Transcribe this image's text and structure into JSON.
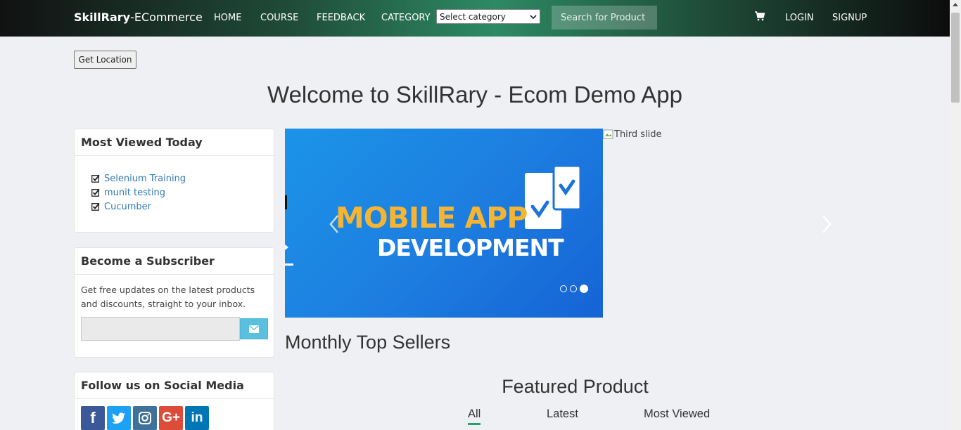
{
  "navbar": {
    "brand_bold": "SkillRary",
    "brand_rest": "-ECommerce",
    "home": "HOME",
    "course": "COURSE",
    "feedback": "FEEDBACK",
    "category": "CATEGORY",
    "category_select": "Select category",
    "search_placeholder": "Search for Product",
    "cart_icon": "shopping-cart-icon",
    "login": "LOGIN",
    "signup": "SIGNUP"
  },
  "get_location": "Get Location",
  "welcome_title": "Welcome to SkillRary - Ecom Demo App",
  "most_viewed": {
    "title": "Most Viewed Today",
    "items": [
      "Selenium Training",
      "munit testing",
      "Cucumber"
    ]
  },
  "subscriber": {
    "title": "Become a Subscriber",
    "text": "Get free updates on the latest products and discounts, straight to your inbox.",
    "button_icon": "envelope-icon"
  },
  "social": {
    "title": "Follow us on Social Media",
    "networks": [
      {
        "name": "facebook",
        "glyph": "f",
        "color": "#3b5998"
      },
      {
        "name": "twitter",
        "glyph": "t",
        "color": "#1da1f2"
      },
      {
        "name": "instagram",
        "glyph": "ig",
        "color": "#3f729b"
      },
      {
        "name": "google-plus",
        "glyph": "G+",
        "color": "#dd4b39"
      },
      {
        "name": "linkedin",
        "glyph": "in",
        "color": "#0077b5"
      }
    ]
  },
  "carousel": {
    "slide_line1": "MOBILE APP",
    "slide_line2": "DEVELOPMENT",
    "broken_alt": "Third slide",
    "slide_count": 3,
    "active_slide": 3
  },
  "monthly_title": "Monthly Top Sellers",
  "featured": {
    "title": "Featured Product",
    "tabs": [
      "All",
      "Latest",
      "Most Viewed"
    ],
    "active_tab": "All"
  },
  "colors": {
    "accent_green": "#2aa06b",
    "link_blue": "#337ab7",
    "slide_orange": "#f5b431"
  }
}
